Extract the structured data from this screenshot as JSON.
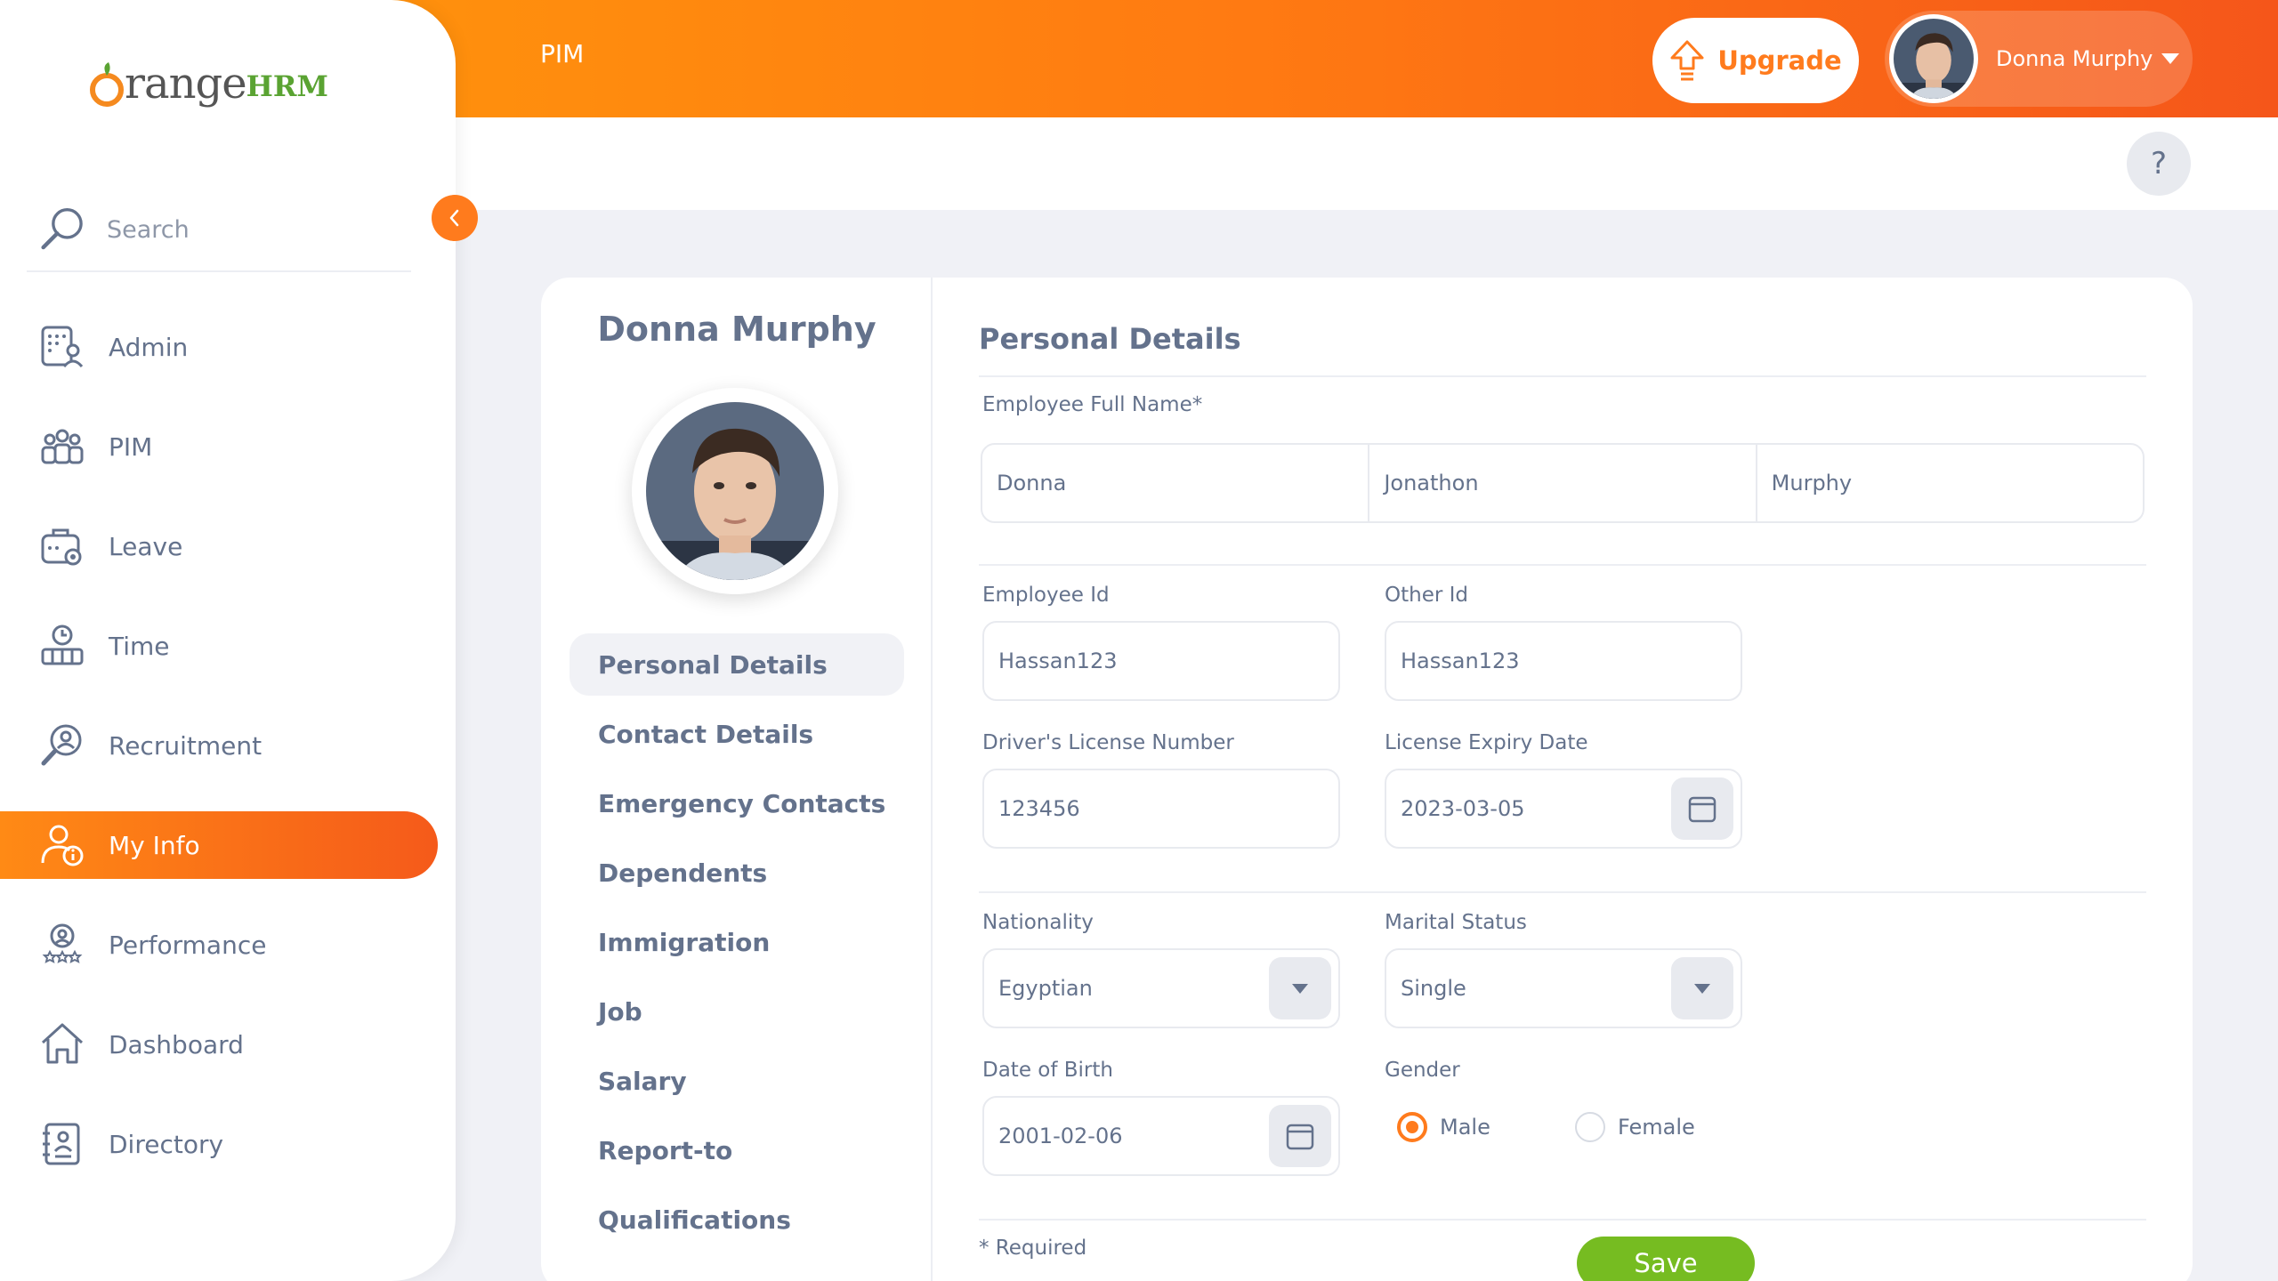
{
  "topbar": {
    "title": "PIM",
    "upgrade_label": "Upgrade",
    "user_name": "Donna Murphy"
  },
  "help": {
    "label": "?"
  },
  "sidebar": {
    "brand_word": "range",
    "brand_hrm": "HRM",
    "search_placeholder": "Search",
    "items": [
      {
        "label": "Admin",
        "icon": "admin-icon"
      },
      {
        "label": "PIM",
        "icon": "pim-icon"
      },
      {
        "label": "Leave",
        "icon": "leave-icon"
      },
      {
        "label": "Time",
        "icon": "time-icon"
      },
      {
        "label": "Recruitment",
        "icon": "recruitment-icon"
      },
      {
        "label": "My Info",
        "icon": "my-info-icon",
        "active": true
      },
      {
        "label": "Performance",
        "icon": "performance-icon"
      },
      {
        "label": "Dashboard",
        "icon": "dashboard-icon"
      },
      {
        "label": "Directory",
        "icon": "directory-icon"
      }
    ]
  },
  "profile": {
    "name": "Donna Murphy",
    "tabs": [
      {
        "label": "Personal Details",
        "active": true
      },
      {
        "label": "Contact Details"
      },
      {
        "label": "Emergency Contacts"
      },
      {
        "label": "Dependents"
      },
      {
        "label": "Immigration"
      },
      {
        "label": "Job"
      },
      {
        "label": "Salary"
      },
      {
        "label": "Report-to"
      },
      {
        "label": "Qualifications"
      }
    ]
  },
  "form": {
    "title": "Personal Details",
    "full_name_label": "Employee Full Name*",
    "first_name": "Donna",
    "middle_name": "Jonathon",
    "last_name": "Murphy",
    "employee_id_label": "Employee Id",
    "employee_id": "Hassan123",
    "other_id_label": "Other Id",
    "other_id": "Hassan123",
    "license_label": "Driver's License Number",
    "license": "123456",
    "license_expiry_label": "License Expiry Date",
    "license_expiry": "2023-03-05",
    "nationality_label": "Nationality",
    "nationality": "Egyptian",
    "marital_label": "Marital Status",
    "marital": "Single",
    "dob_label": "Date of Birth",
    "dob": "2001-02-06",
    "gender_label": "Gender",
    "gender_male": "Male",
    "gender_female": "Female",
    "gender_selected": "Male",
    "required_note": "* Required",
    "save_label": "Save"
  },
  "colors": {
    "accent": "#ff7b1d",
    "save": "#76bc21",
    "text": "#64728c"
  }
}
